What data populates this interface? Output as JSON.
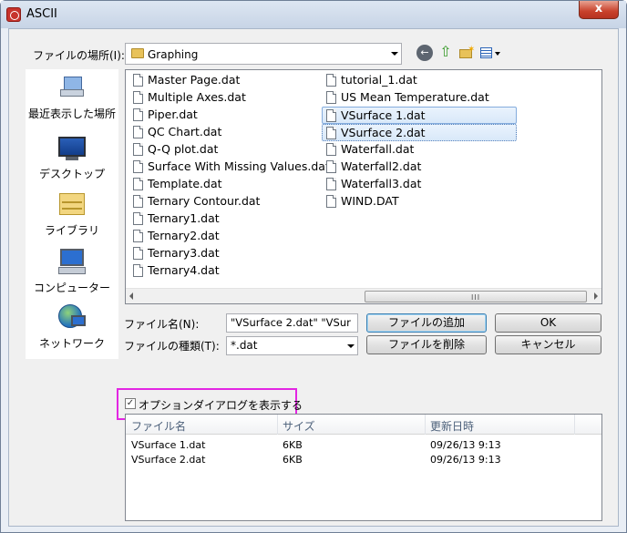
{
  "window": {
    "title": "ASCII",
    "close_glyph": "x"
  },
  "toolbar": {
    "look_in_label": "ファイルの場所(I):",
    "look_in_value": "Graphing",
    "back_glyph": "←",
    "up_glyph": "⇧"
  },
  "places": [
    {
      "label": "最近表示した場所",
      "icon": "recent-places-icon"
    },
    {
      "label": "デスクトップ",
      "icon": "desktop-icon"
    },
    {
      "label": "ライブラリ",
      "icon": "libraries-icon"
    },
    {
      "label": "コンピューター",
      "icon": "computer-icon"
    },
    {
      "label": "ネットワーク",
      "icon": "network-icon"
    }
  ],
  "files": {
    "column1": [
      "Master Page.dat",
      "Multiple Axes.dat",
      "Piper.dat",
      "QC Chart.dat",
      "Q-Q plot.dat",
      "Surface With Missing Values.dat",
      "Template.dat",
      "Ternary Contour.dat",
      "Ternary1.dat",
      "Ternary2.dat",
      "Ternary3.dat",
      "Ternary4.dat"
    ],
    "column2": [
      "tutorial_1.dat",
      "US Mean Temperature.dat",
      "VSurface 1.dat",
      "VSurface 2.dat",
      "Waterfall.dat",
      "Waterfall2.dat",
      "Waterfall3.dat",
      "WIND.DAT"
    ],
    "selected": [
      "VSurface 1.dat",
      "VSurface 2.dat"
    ],
    "scroll_grip": "III"
  },
  "form": {
    "file_name_label": "ファイル名(N):",
    "file_name_value": "\"VSurface 2.dat\" \"VSur",
    "file_type_label": "ファイルの種類(T):",
    "file_type_value": "*.dat",
    "add_file_button": "ファイルの追加",
    "remove_file_button": "ファイルを削除",
    "ok_button": "OK",
    "cancel_button": "キャンセル"
  },
  "options": {
    "show_options_label": "オプションダイアログを表示する",
    "show_options_checked": true,
    "check_glyph": "✓",
    "highlight_color": "#e326e3"
  },
  "added_files": {
    "headers": [
      "ファイル名",
      "サイズ",
      "更新日時"
    ],
    "rows": [
      {
        "name": "VSurface 1.dat",
        "size": "6KB",
        "modified": "09/26/13 9:13"
      },
      {
        "name": "VSurface 2.dat",
        "size": "6KB",
        "modified": "09/26/13 9:13"
      }
    ]
  }
}
